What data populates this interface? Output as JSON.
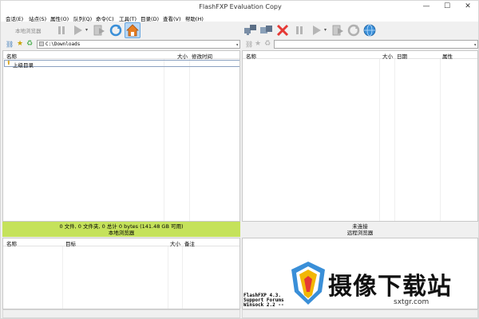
{
  "window": {
    "title": "FlashFXP Evaluation Copy",
    "minimize": "—",
    "maximize": "☐",
    "close": "✕"
  },
  "menu": [
    "会话(E)",
    "站点(S)",
    "属性(O)",
    "队列(Q)",
    "命令(C)",
    "工具(T)",
    "目录(D)",
    "查看(V)",
    "帮助(H)"
  ],
  "local": {
    "browser_button": "本地浏览器",
    "path": "C:\\Downloads",
    "columns": {
      "name": "名称",
      "size": "大小",
      "modified": "修改时间"
    },
    "up_item": "上级目录",
    "status_line1": "0 文件, 0 文件夹, 0 总计 0 bytes (141.48 GB 可用)",
    "status_line2": "本地浏览器",
    "status_color": "#c5e25b"
  },
  "remote": {
    "path": "",
    "columns": {
      "name": "名称",
      "size": "大小",
      "date": "日期",
      "attr": "属性"
    },
    "status_line1": "未连接",
    "status_line2": "远程浏览器"
  },
  "queue": {
    "columns": {
      "name": "名称",
      "target": "目标",
      "size": "大小",
      "note": "备注"
    }
  },
  "log": {
    "lines": [
      "FlashFXP 4.3.",
      "Support Forums",
      "Winsock 2.2 -- "
    ]
  },
  "watermark": {
    "text": "摄像下载站",
    "url": "sxtgr.com"
  },
  "colors": {
    "accent": "#3a8fd8",
    "stop": "#e53935",
    "home_bg": "#b6d7f5"
  }
}
